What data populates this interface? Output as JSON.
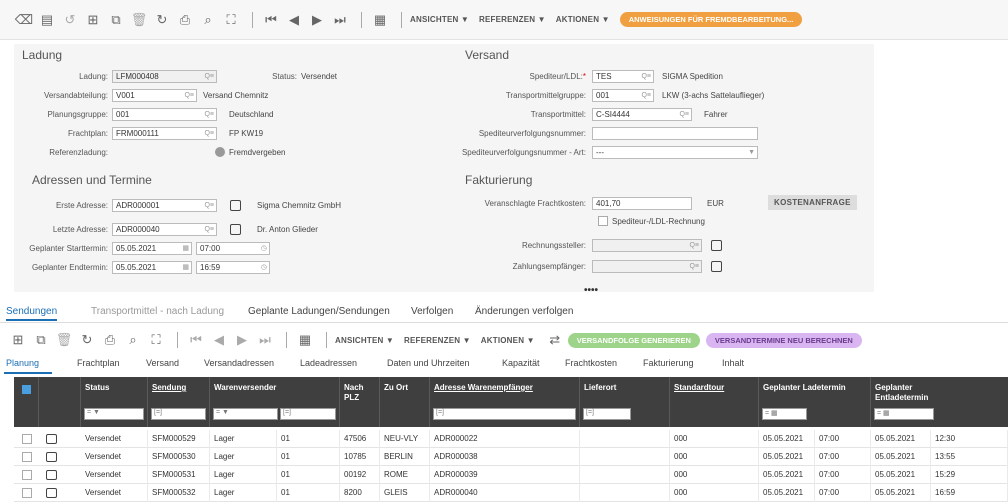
{
  "toolbar": {
    "menus": [
      "ANSICHTEN ▼",
      "REFERENZEN ▼",
      "AKTIONEN ▼"
    ],
    "primary_action": "ANWEISUNGEN FÜR FREMDBEARBEITUNG..."
  },
  "ladung": {
    "section": "Ladung",
    "ladung_label": "Ladung:",
    "ladung_value": "LFM000408",
    "status_label": "Status:",
    "status_value": "Versendet",
    "versandabteilung_label": "Versandabteilung:",
    "versandabteilung_value": "V001",
    "versandabteilung_text": "Versand Chemnitz",
    "planungsgruppe_label": "Planungsgruppe:",
    "planungsgruppe_value": "001",
    "planungsgruppe_text": "Deutschland",
    "frachtplan_label": "Frachtplan:",
    "frachtplan_value": "FRM000111",
    "frachtplan_text": "FP KW19",
    "referenzladung_label": "Referenzladung:",
    "referenzladung_text": "Fremdvergeben"
  },
  "versand": {
    "section": "Versand",
    "spediteur_label": "Spediteur/LDL:",
    "spediteur_value": "TES",
    "spediteur_text": "SIGMA Spedition",
    "tmgruppe_label": "Transportmittelgruppe:",
    "tmgruppe_value": "001",
    "tmgruppe_text": "LKW (3-achs Sattelauflieger)",
    "tm_label": "Transportmittel:",
    "tm_value": "C-SI4444",
    "tm_text": "Fahrer",
    "svn_label": "Spediteurverfolgungsnummer:",
    "svn_value": "",
    "svnart_label": "Spediteurverfolgungsnummer - Art:",
    "svnart_value": "---"
  },
  "adressen": {
    "section": "Adressen und Termine",
    "erste_label": "Erste Adresse:",
    "erste_value": "ADR000001",
    "erste_text": "Sigma Chemnitz GmbH",
    "letzte_label": "Letzte Adresse:",
    "letzte_value": "ADR000040",
    "letzte_text": "Dr. Anton Glieder",
    "start_label": "Geplanter Starttermin:",
    "start_date": "05.05.2021",
    "start_time": "07:00",
    "end_label": "Geplanter Endtermin:",
    "end_date": "05.05.2021",
    "end_time": "16:59"
  },
  "fakturierung": {
    "section": "Fakturierung",
    "kosten_label": "Veranschlagte Frachtkosten:",
    "kosten_value": "401,70",
    "currency": "EUR",
    "kosten_button": "KOSTENANFRAGE",
    "rechnung_check": "Spediteur-/LDL-Rechnung",
    "steller_label": "Rechnungssteller:",
    "empf_label": "Zahlungsempfänger:"
  },
  "more": "••••",
  "tabs": [
    "Sendungen",
    "Transportmittel - nach Ladung",
    "Geplante Ladungen/Sendungen",
    "Verfolgen",
    "Änderungen verfolgen"
  ],
  "toolbar2": {
    "menus": [
      "ANSICHTEN ▼",
      "REFERENZEN ▼",
      "AKTIONEN ▼"
    ],
    "btn_green": "VERSANDFOLGE GENERIEREN",
    "btn_purple": "VERSANDTERMINE NEU BERECHNEN"
  },
  "subtabs": [
    "Planung",
    "Frachtplan",
    "Versand",
    "Versandadressen",
    "Ladeadressen",
    "Daten und Uhrzeiten",
    "Kapazität",
    "Frachtkosten",
    "Fakturierung",
    "Inhalt"
  ],
  "grid": {
    "headers": [
      "Status",
      "Sendung",
      "Warenversender",
      "Nach PLZ",
      "Zu Ort",
      "Adresse Warenempfänger",
      "Lieferort",
      "Standardtour",
      "Geplanter Ladetermin",
      "Geplanter Entladetermin"
    ],
    "filter_eq": "=",
    "rows": [
      [
        "Versendet",
        "SFM000529",
        "Lager",
        "01",
        "47506",
        "NEU-VLY",
        "ADR000022",
        "",
        "000",
        "05.05.2021",
        "07:00",
        "05.05.2021",
        "12:30"
      ],
      [
        "Versendet",
        "SFM000530",
        "Lager",
        "01",
        "10785",
        "BERLIN",
        "ADR000038",
        "",
        "000",
        "05.05.2021",
        "07:00",
        "05.05.2021",
        "13:55"
      ],
      [
        "Versendet",
        "SFM000531",
        "Lager",
        "01",
        "00192",
        "ROME",
        "ADR000039",
        "",
        "000",
        "05.05.2021",
        "07:00",
        "05.05.2021",
        "15:29"
      ],
      [
        "Versendet",
        "SFM000532",
        "Lager",
        "01",
        "8200",
        "GLEIS",
        "ADR000040",
        "",
        "000",
        "05.05.2021",
        "07:00",
        "05.05.2021",
        "16:59"
      ]
    ]
  }
}
